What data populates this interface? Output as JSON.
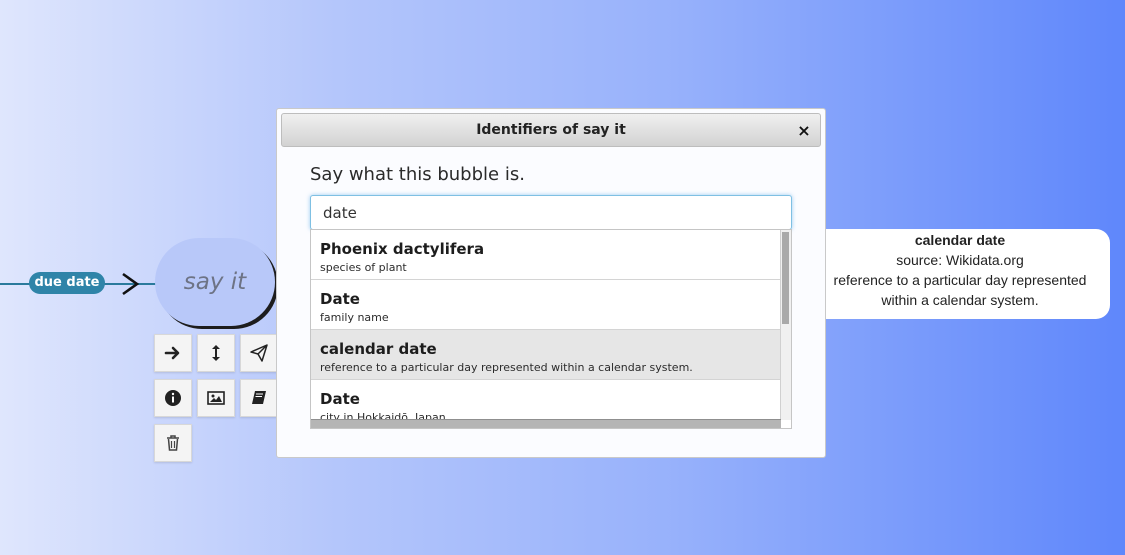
{
  "graph": {
    "edge_label": "due date",
    "bubble_text": "say it"
  },
  "toolbar": {
    "buttons": [
      {
        "icon": "arrow-right-icon"
      },
      {
        "icon": "vertical-resize-icon"
      },
      {
        "icon": "paper-plane-icon"
      },
      {
        "icon": "info-icon"
      },
      {
        "icon": "image-icon"
      },
      {
        "icon": "book-icon"
      },
      {
        "icon": "trash-icon"
      }
    ]
  },
  "dialog": {
    "title": "Identifiers of say it",
    "close_label": "×",
    "prompt": "Say what this bubble is.",
    "search_value": "date",
    "results": [
      {
        "label": "Phoenix dactylifera",
        "description": "species of plant"
      },
      {
        "label": "Date",
        "description": "family name"
      },
      {
        "label": "calendar date",
        "description": "reference to a particular day represented within a calendar system."
      },
      {
        "label": "Date",
        "description": "city in Hokkaidō, Japan"
      }
    ],
    "active_result_index": 2
  },
  "tooltip": {
    "title": "calendar date",
    "source": "source: Wikidata.org",
    "description": "reference to a particular day represented within a calendar system."
  },
  "colors": {
    "edge": "#2a7a9c",
    "edge_label_bg": "#2f84a8",
    "bubble_bg": "#b8c8f9",
    "active_row": "#e6e6e6",
    "input_focus": "#7fc0e3"
  }
}
